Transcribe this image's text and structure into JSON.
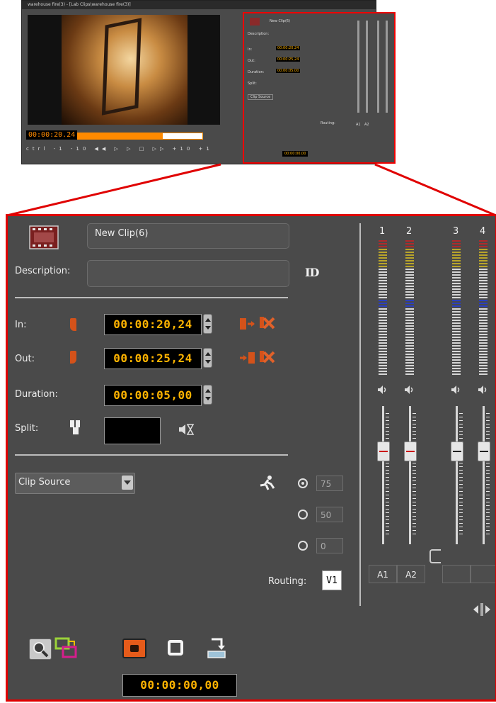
{
  "thumbnail": {
    "title": "warehouse fire(3) - [Lab Clips\\warehouse fire(3)]",
    "timecode": "00:00:20.24",
    "transport": "-1 -10 ◀◀ ▷ ▷ □ ▷▷ +10 +1",
    "shortcut_label": "ctrl",
    "clip_name": "New Clip(6)",
    "description_label": "Description:",
    "in_label": "In:",
    "out_label": "Out:",
    "duration_label": "Duration:",
    "split_label": "Split:",
    "in_value": "00:00:20,24",
    "out_value": "00:00:25,24",
    "duration_value": "00:00:05,00",
    "source_label": "Clip Source",
    "routing_label": "Routing:",
    "routing_value": "V1",
    "a1": "A1",
    "a2": "A2",
    "bottom_timecode": "00:00:00,00"
  },
  "clip": {
    "name": "New Clip(6)",
    "description_label": "Description:",
    "description_value": "",
    "id_button": "ID"
  },
  "times": {
    "in_label": "In:",
    "in_value": "00:00:20,24",
    "out_label": "Out:",
    "out_value": "00:00:25,24",
    "duration_label": "Duration:",
    "duration_value": "00:00:05,00",
    "split_label": "Split:"
  },
  "source": {
    "selected": "Clip Source",
    "radio_options": [
      "75",
      "50",
      "0"
    ],
    "routing_label": "Routing:",
    "routing_value": "V1"
  },
  "mixer": {
    "channels": [
      "1",
      "2",
      "3",
      "4"
    ],
    "route_cells": [
      "A1",
      "A2",
      "",
      ""
    ]
  },
  "footer": {
    "timecode": "00:00:00,00"
  },
  "colors": {
    "panel_bg": "#4a4a4a",
    "highlight_border": "#e00000",
    "timecode_text": "#ffb300",
    "in_out_marker": "#d4521a"
  }
}
